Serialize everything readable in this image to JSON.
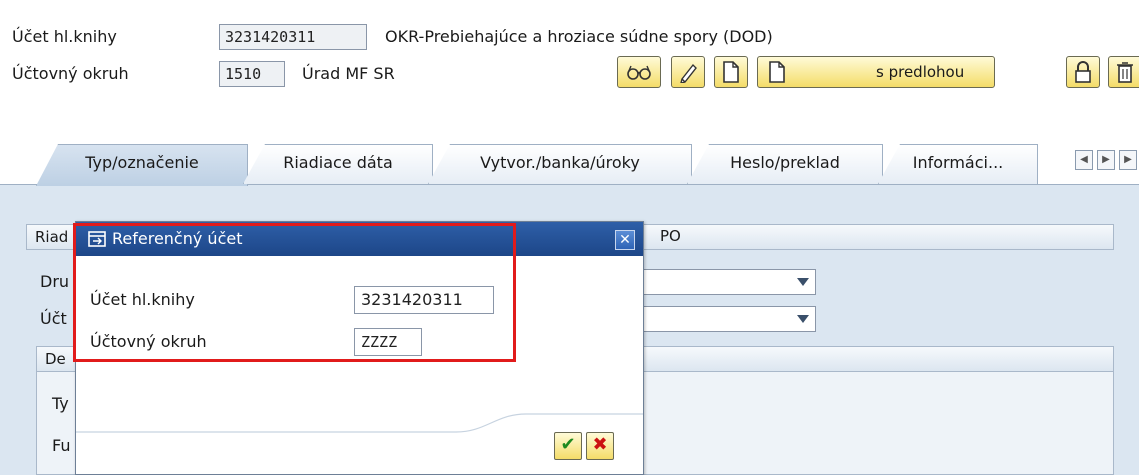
{
  "header": {
    "gl_account_label": "Účet hl.knihy",
    "gl_account_value": "3231420311",
    "gl_account_desc": "OKR-Prebiehajúce a hroziace súdne spory (DOD)",
    "chart_label": "Účtovný okruh",
    "chart_value": "1510",
    "chart_desc": "Úrad MF SR"
  },
  "toolbar": {
    "with_template_label": "s predlohou"
  },
  "tabs": [
    {
      "label": "Typ/označenie"
    },
    {
      "label": "Riadiace dáta"
    },
    {
      "label": "Vytvor./banka/úroky"
    },
    {
      "label": "Heslo/preklad"
    },
    {
      "label": "Informáci..."
    }
  ],
  "background": {
    "group1_fragment": "Riad",
    "group1_fragment_right": "PO",
    "row1_fragment": "Dru",
    "row2_fragment": "Účt",
    "group2_fragment": "De",
    "row3_fragment": "Ty",
    "row4_fragment": "Fu"
  },
  "dialog": {
    "title": "Referenčný účet",
    "close_glyph": "✕",
    "gl_account_label": "Účet hl.knihy",
    "gl_account_value": "3231420311",
    "chart_label": "Účtovný okruh",
    "chart_value": "ZZZZ",
    "ok_glyph": "✔",
    "cancel_glyph": "✖"
  },
  "colors": {
    "title_bar": "#1d4688",
    "highlight": "#e11b1b",
    "button_face": "#f4dc68"
  }
}
